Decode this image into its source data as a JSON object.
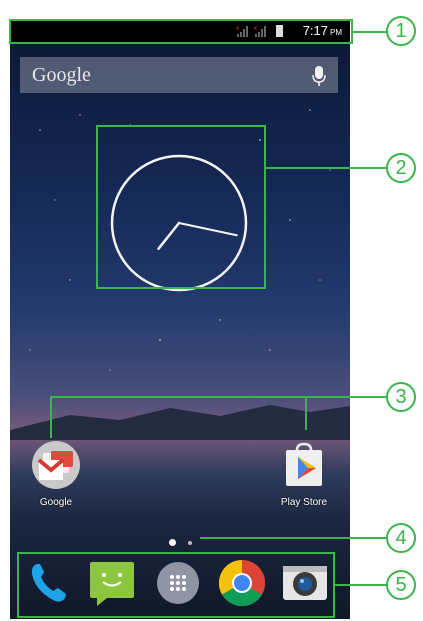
{
  "status_bar": {
    "time": "7:17",
    "ampm": "PM"
  },
  "search": {
    "logo": "Google",
    "mic_icon": "microphone-icon"
  },
  "clock_widget": {
    "type": "analog-clock",
    "hour": 7,
    "minute": 17
  },
  "home_apps": [
    {
      "label": "Google",
      "icon": "gmail-folder-icon"
    },
    {
      "label": "Play Store",
      "icon": "play-store-icon"
    }
  ],
  "page_indicator": {
    "pages": 2,
    "current": 1
  },
  "dock": [
    {
      "icon": "phone-icon"
    },
    {
      "icon": "messaging-icon"
    },
    {
      "icon": "app-drawer-icon"
    },
    {
      "icon": "chrome-icon"
    },
    {
      "icon": "camera-icon"
    }
  ],
  "callouts": [
    "1",
    "2",
    "3",
    "4",
    "5"
  ],
  "colors": {
    "callout": "#3bb44a",
    "status_bar": "#000000",
    "sky_top": "#0b1633",
    "sky_dusk": "#785a7d"
  }
}
